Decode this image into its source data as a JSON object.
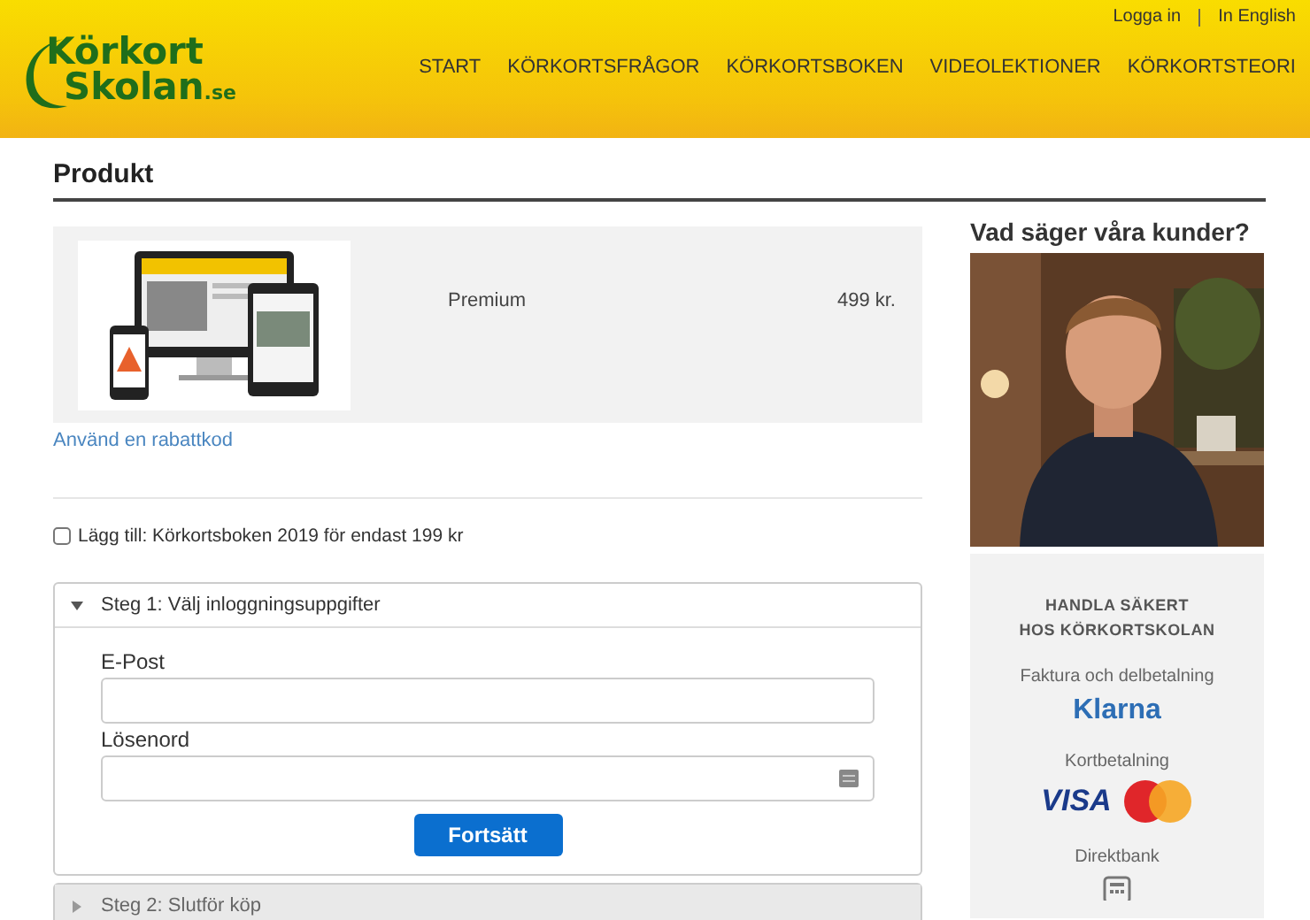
{
  "header": {
    "logo": {
      "line1": "Körkort",
      "line2": "Skolan",
      "suffix": ".se"
    },
    "top_links": [
      "Logga in",
      "In English"
    ],
    "nav": [
      "START",
      "KÖRKORTSFRÅGOR",
      "KÖRKORTSBOKEN",
      "VIDEOLEKTIONER",
      "KÖRKORTSTEORI"
    ]
  },
  "page_title": "Produkt",
  "product": {
    "name": "Premium",
    "price": "499 kr."
  },
  "discount_link": "Använd en rabattkod",
  "addon": {
    "label": "Lägg till: Körkortsboken 2019 för endast  199 kr",
    "checked": false
  },
  "steps": [
    {
      "title": "Steg 1: Välj inloggningsuppgifter",
      "expanded": true,
      "fields": [
        {
          "label": "E-Post",
          "kind": "text"
        },
        {
          "label": "Lösenord",
          "kind": "password"
        }
      ],
      "button": "Fortsätt"
    },
    {
      "title": "Steg 2: Slutför köp",
      "expanded": false
    }
  ],
  "sidebar": {
    "testimonials_title": "Vad säger våra kunder?",
    "secure": {
      "title_lines": [
        "HANDLA SÄKERT",
        "HOS KÖRKORTSKOLAN"
      ],
      "methods": [
        {
          "label": "Faktura och delbetalning",
          "logos": [
            {
              "kind": "klarna",
              "text": "Klarna"
            }
          ]
        },
        {
          "label": "Kortbetalning",
          "logos": [
            {
              "kind": "visa",
              "text": "VISA"
            },
            {
              "kind": "mastercard"
            }
          ]
        },
        {
          "label": "Direktbank",
          "logos": [
            {
              "kind": "bank"
            }
          ]
        }
      ]
    }
  }
}
